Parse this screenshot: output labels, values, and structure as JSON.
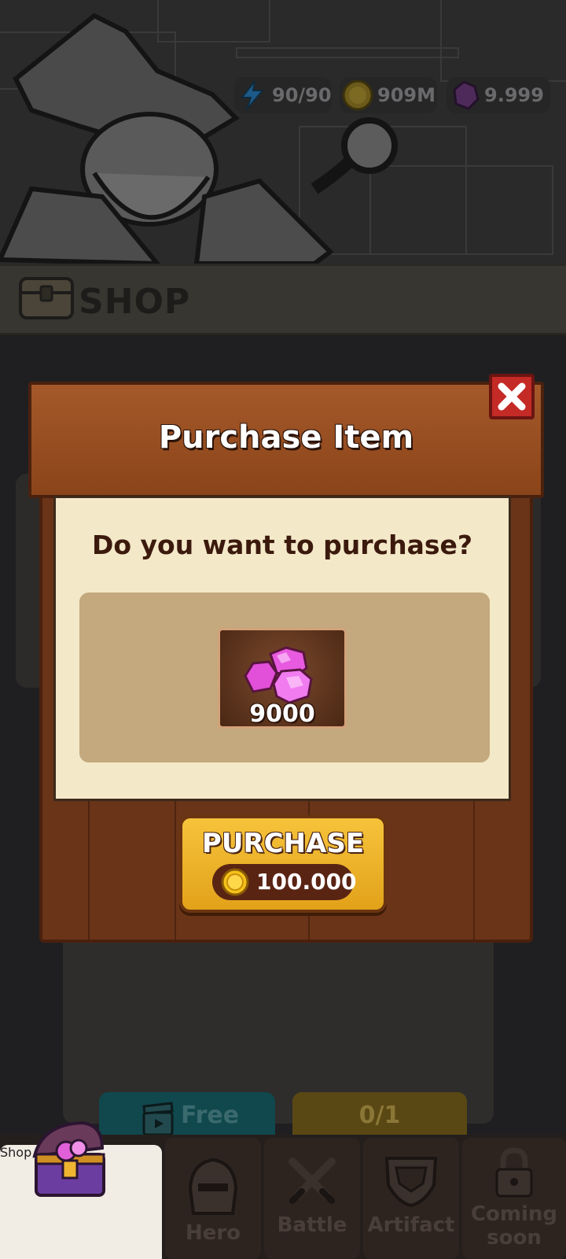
{
  "resources": {
    "energy": "90/90",
    "coins": "909M",
    "gems": "9.999"
  },
  "shop_header": {
    "title": "SHOP"
  },
  "dialog": {
    "title": "Purchase Item",
    "question": "Do you want to purchase?",
    "item": {
      "icon": "gem-icon",
      "quantity": "9000"
    },
    "purchase_button": {
      "label": "PURCHASE",
      "price": "100.000",
      "currency_icon": "coin-icon"
    }
  },
  "background_buttons": {
    "free": "Free",
    "progress": "0/1"
  },
  "bottom_nav": {
    "tabs": [
      {
        "label": "Shop",
        "icon": "treasure-chest-icon"
      },
      {
        "label": "Hero",
        "icon": "helmet-icon"
      },
      {
        "label": "Battle",
        "icon": "crossed-swords-icon"
      },
      {
        "label": "Artifact",
        "icon": "armor-icon"
      },
      {
        "label": "Coming\nsoon",
        "icon": "lock-icon"
      }
    ]
  },
  "colors": {
    "header_wood": "#a5592a",
    "parchment": "#f3e8c8",
    "purchase_gold": "#f6c33b",
    "close_red": "#c42a26"
  }
}
